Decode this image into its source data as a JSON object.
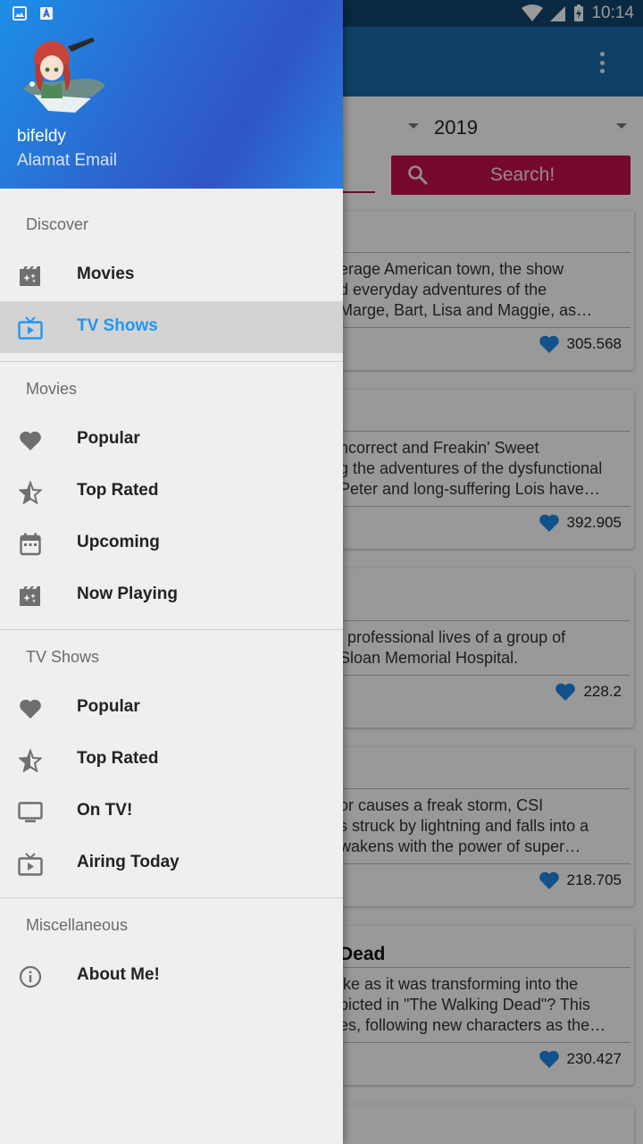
{
  "status_bar": {
    "time": "10:14"
  },
  "toolbar": {
    "overflow_icon": "more-vert-icon"
  },
  "filters": {
    "year": "2019",
    "search_label": "Search!"
  },
  "cards": [
    {
      "title": "",
      "overview": "erage American town, the show\nd everyday adventures of the\nMarge, Bart, Lisa and Maggie, as…",
      "rating": "305.568"
    },
    {
      "title": "",
      "overview": "ncorrect and Freakin' Sweet\ng the adventures of the dysfunctional\nPeter and long-suffering Lois have…",
      "rating": "392.905"
    },
    {
      "title": "",
      "overview": "l professional lives of a group of\nSloan Memorial Hospital.",
      "rating": "228.2"
    },
    {
      "title": "",
      "overview": "or causes a freak storm, CSI\ns struck by lightning and falls into a\nwakens with the power of super…",
      "rating": "218.705"
    },
    {
      "title": "Dead",
      "overview": "ike as it was transforming into the\npicted in \"The Walking Dead\"? This\nes, following new characters as the…",
      "rating": "230.427"
    }
  ],
  "drawer": {
    "user_name": "bifeldy",
    "user_email": "Alamat Email",
    "sections": {
      "discover": "Discover",
      "movies": "Movies",
      "tv_shows": "TV Shows",
      "misc": "Miscellaneous"
    },
    "discover_items": [
      {
        "label": "Movies",
        "icon": "movie-filter-icon"
      },
      {
        "label": "TV Shows",
        "icon": "live-tv-icon",
        "active": true
      }
    ],
    "movie_items": [
      {
        "label": "Popular",
        "icon": "heart-icon"
      },
      {
        "label": "Top Rated",
        "icon": "star-half-icon"
      },
      {
        "label": "Upcoming",
        "icon": "calendar-icon"
      },
      {
        "label": "Now Playing",
        "icon": "movie-filter-icon"
      }
    ],
    "tv_items": [
      {
        "label": "Popular",
        "icon": "heart-icon"
      },
      {
        "label": "Top Rated",
        "icon": "star-half-icon"
      },
      {
        "label": "On TV!",
        "icon": "tv-icon"
      },
      {
        "label": "Airing Today",
        "icon": "live-tv-icon"
      }
    ],
    "misc_items": [
      {
        "label": "About Me!",
        "icon": "info-icon"
      }
    ]
  },
  "colors": {
    "primary": "#1b6aa8",
    "accent": "#c3104a",
    "active_item": "#2196f3",
    "heart": "#1e88e5"
  }
}
